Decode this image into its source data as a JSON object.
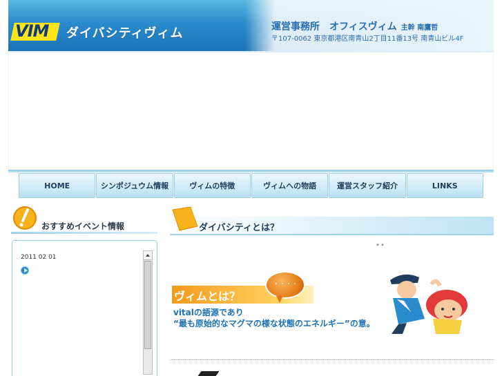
{
  "header": {
    "logo": "VIM",
    "brand": "ダイバシティヴィム",
    "office_label": "運営事務所　オフィスヴィム",
    "chief": "主幹 南鷹哲",
    "address": "〒107-0062 東京都港区南青山2丁目11番13号 南青山ビル4F"
  },
  "nav": {
    "items": [
      {
        "label": "HOME"
      },
      {
        "label": "シンポジュウム情報"
      },
      {
        "label": "ヴィムの特徴"
      },
      {
        "label": "ヴィムへの物語"
      },
      {
        "label": "運営スタッフ紹介"
      },
      {
        "label": "LINKS"
      }
    ]
  },
  "left": {
    "title": "おすすめイベント情報",
    "event_date": "2011 02 01"
  },
  "right": {
    "title": "ダイバシティとは？",
    "quote": "\" \"",
    "vim_banner": "ヴィムとは？",
    "bubble_text": "・・・・",
    "desc_line1": "vitalの語源であり",
    "desc_line2": "“最も原始的なマグマの様な状態のエネルギー”の意。"
  },
  "colors": {
    "accent_blue": "#1c72b5",
    "logo_yellow": "#ffe41a",
    "banner_orange": "#f29a1e"
  }
}
